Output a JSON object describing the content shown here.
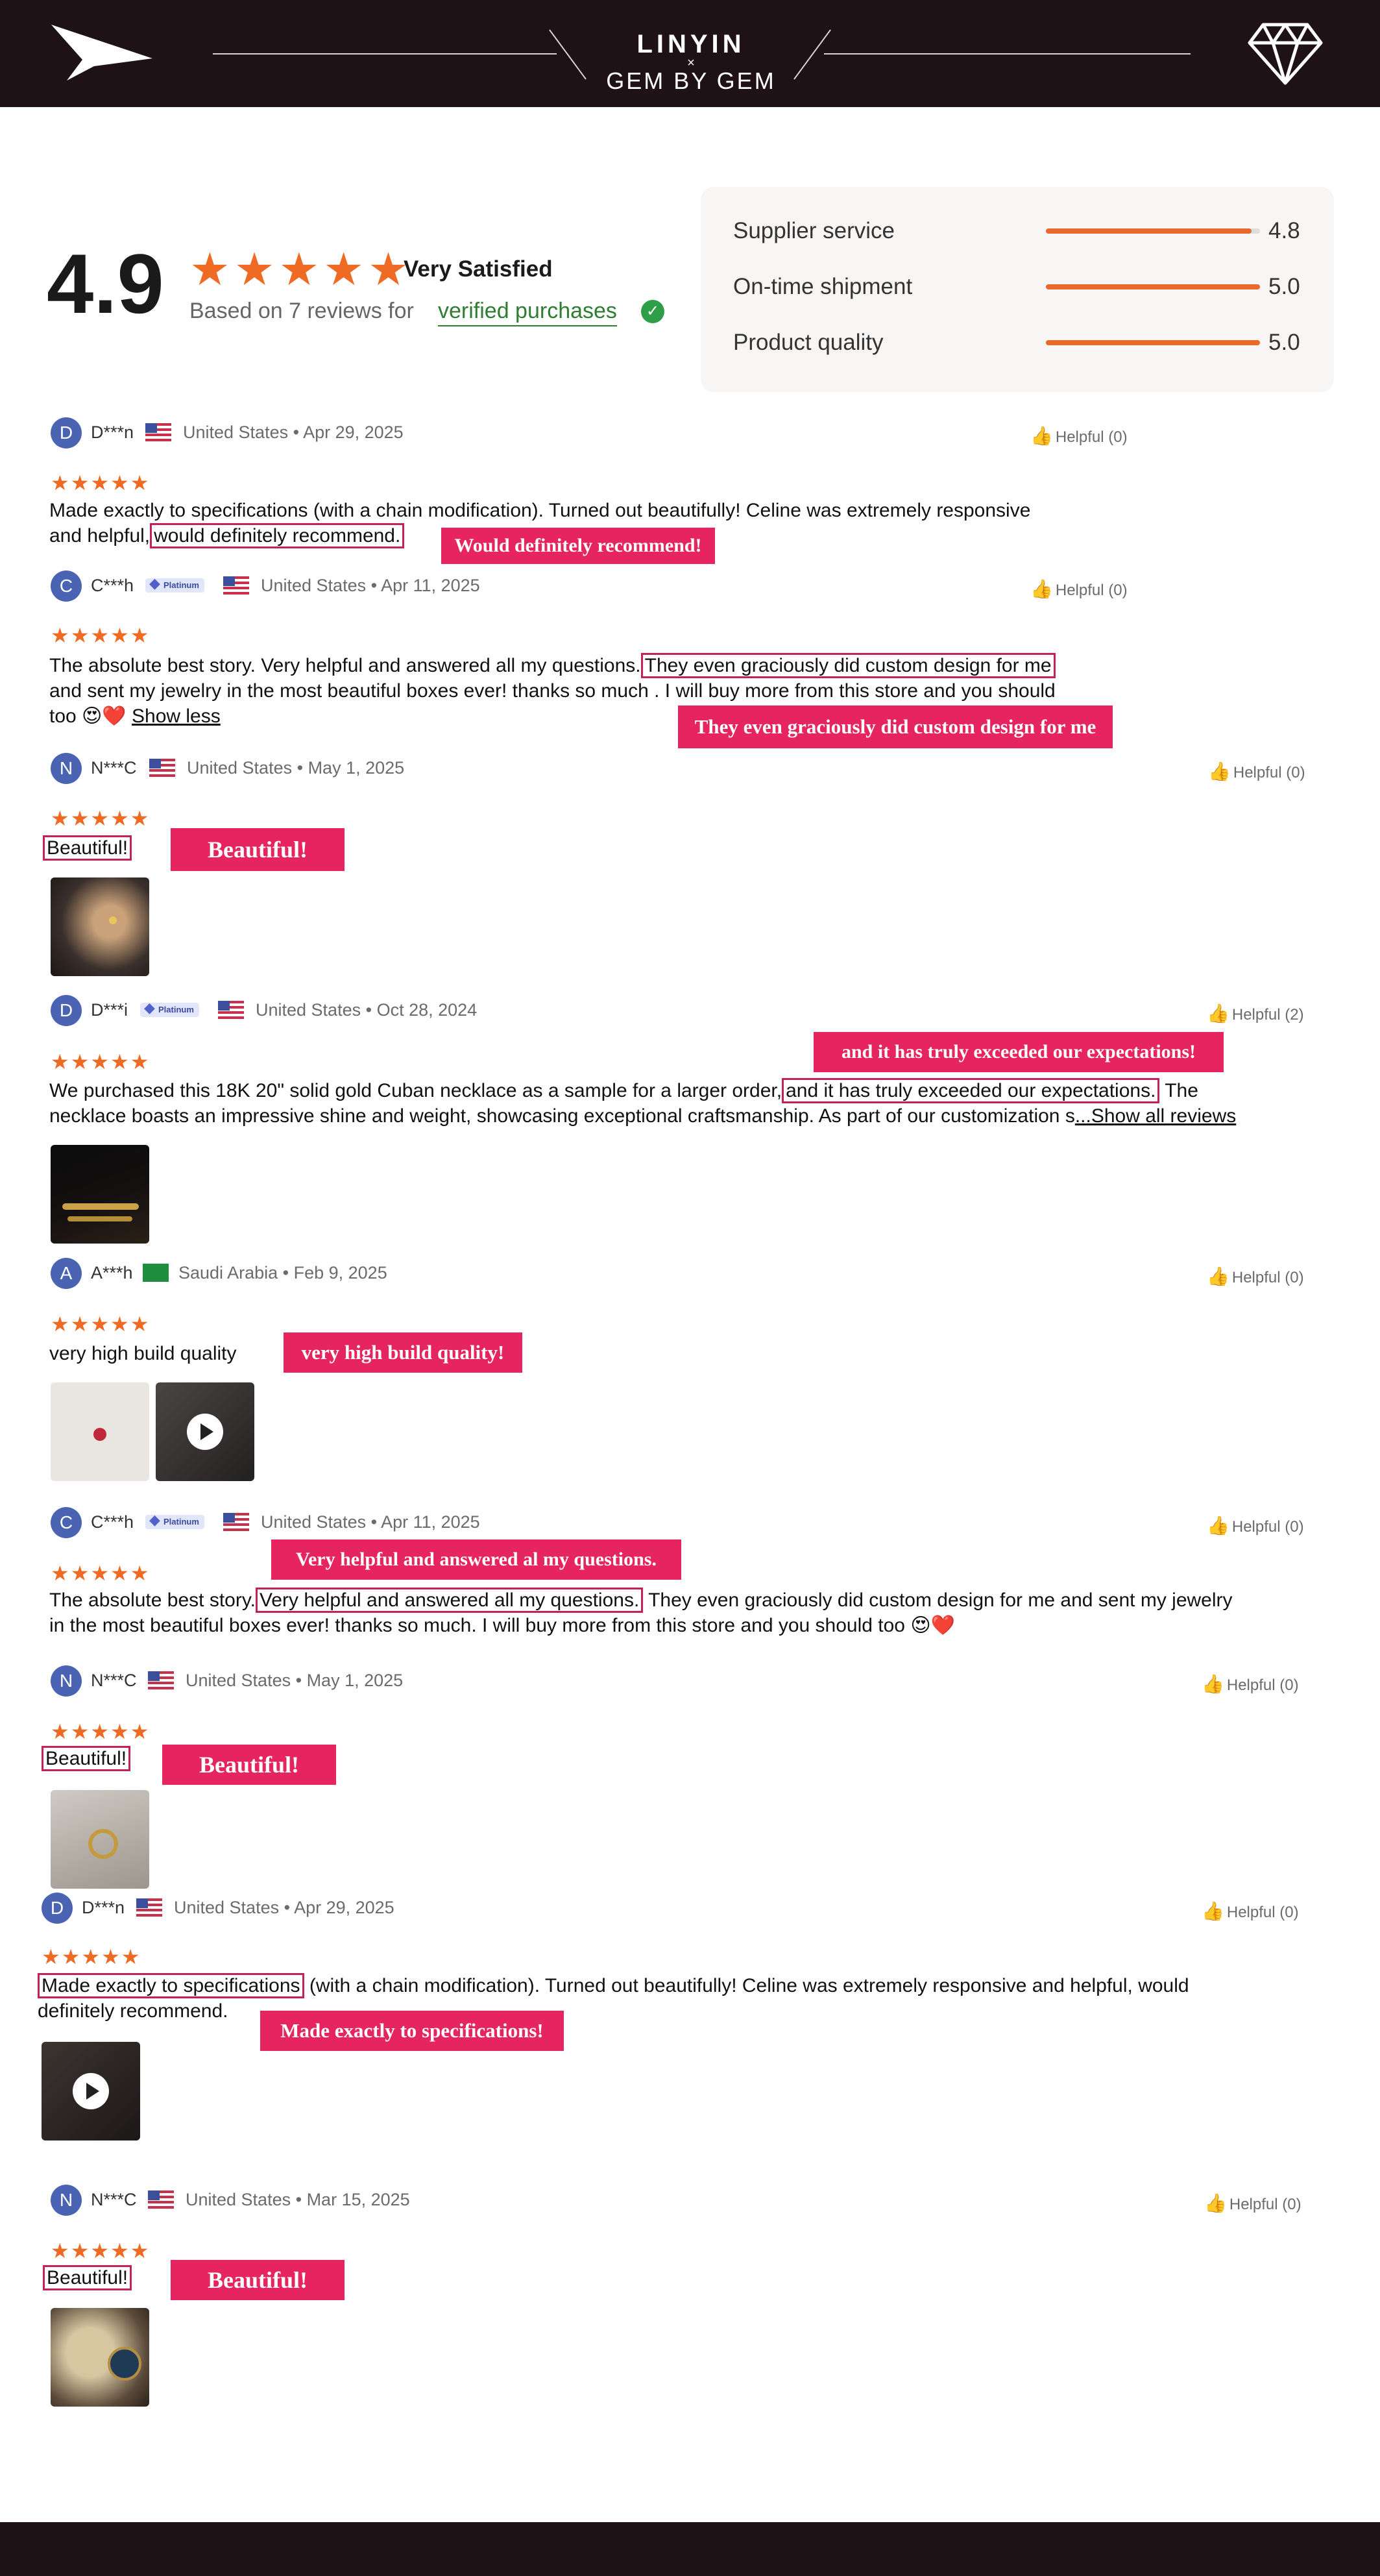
{
  "brand": {
    "primary": "LINYIN",
    "times": "×",
    "secondary": "GEM BY GEM",
    "logo_icon": "bird-wing-icon",
    "right_icon": "diamond-icon"
  },
  "colors": {
    "header_bg": "#1e1217",
    "accent_orange": "#ef6a23",
    "highlight": "#e6245f",
    "verified_green": "#2e7d32",
    "avatar_blue": "#4b63b3"
  },
  "summary": {
    "rating": "4.9",
    "stars": "★★★★★",
    "label": "Very Satisfied",
    "based_on": "Based on 7 reviews for",
    "verified_link": "verified purchases",
    "verified_icon": "verified-check-icon"
  },
  "scores": [
    {
      "label": "Supplier service",
      "value": "4.8",
      "fraction": 0.96
    },
    {
      "label": "On-time shipment",
      "value": "5.0",
      "fraction": 1.0
    },
    {
      "label": "Product quality",
      "value": "5.0",
      "fraction": 1.0
    }
  ],
  "reviews": [
    {
      "initial": "D",
      "name": "D***n",
      "country": "United States",
      "date": "Apr 29, 2025",
      "helpful": "Helpful (0)",
      "stars": "★★★★★",
      "text_a": "Made exactly to specifications (with a chain modification). Turned out beautifully! Celine was extremely responsive",
      "text_b": "and helpful,",
      "text_hl": "would definitely recommend.",
      "callout": "Would definitely recommend!"
    },
    {
      "initial": "C",
      "name": "C***h",
      "badge": "Platinum",
      "country": "United States",
      "date": "Apr 11, 2025",
      "helpful": "Helpful (0)",
      "stars": "★★★★★",
      "text_a": "The absolute best story. Very helpful and answered all my questions.",
      "text_hl": "They even graciously did custom design for me",
      "text_b": "and sent my jewelry in the most beautiful boxes ever! thanks so much . I will buy more from this store and you should",
      "text_c": "too 😍❤️",
      "show_less": "Show less",
      "callout": "They even graciously did custom design for me"
    },
    {
      "initial": "N",
      "name": "N***C",
      "country": "United States",
      "date": "May 1, 2025",
      "helpful": "Helpful (0)",
      "stars": "★★★★★",
      "text_hl": "Beautiful!",
      "callout": "Beautiful!"
    },
    {
      "initial": "D",
      "name": "D***i",
      "badge": "Platinum",
      "country": "United States",
      "date": "Oct 28, 2024",
      "helpful": "Helpful (2)",
      "stars": "★★★★★",
      "text_a": "We purchased this 18K 20\" solid gold Cuban necklace as a sample for a larger order,",
      "text_hl": "and it has truly exceeded our expectations.",
      "text_a2": "The",
      "text_b": "necklace boasts an impressive shine and weight, showcasing exceptional craftsmanship. As part of our customization s",
      "show_all": "...Show all reviews",
      "callout": "and it has truly exceeded our expectations!"
    },
    {
      "initial": "A",
      "name": "A***h",
      "country": "Saudi Arabia",
      "date": "Feb 9, 2025",
      "helpful": "Helpful (0)",
      "stars": "★★★★★",
      "text_a": "very high build quality",
      "callout": "very high build quality!"
    },
    {
      "initial": "C",
      "name": "C***h",
      "badge": "Platinum",
      "country": "United States",
      "date": "Apr 11, 2025",
      "helpful": "Helpful (0)",
      "stars": "★★★★★",
      "text_a": "The absolute best story.",
      "text_hl": "Very helpful and answered all my questions.",
      "text_a2": "They even graciously did custom design for me and sent my jewelry",
      "text_b": "in the most beautiful boxes ever! thanks so much. I will buy more from this store and you should too 😍❤️",
      "callout": "Very helpful and answered al my questions."
    },
    {
      "initial": "N",
      "name": "N***C",
      "country": "United States",
      "date": "May 1, 2025",
      "helpful": "Helpful (0)",
      "stars": "★★★★★",
      "text_hl": "Beautiful!",
      "callout": "Beautiful!"
    },
    {
      "initial": "D",
      "name": "D***n",
      "country": "United States",
      "date": "Apr 29, 2025",
      "helpful": "Helpful (0)",
      "stars": "★★★★★",
      "text_hl": "Made exactly to specifications",
      "text_a": "(with a chain modification). Turned out beautifully! Celine was extremely responsive and helpful, would",
      "text_b": "definitely recommend.",
      "callout": "Made exactly to specifications!"
    },
    {
      "initial": "N",
      "name": "N***C",
      "country": "United States",
      "date": "Mar 15, 2025",
      "helpful": "Helpful (0)",
      "stars": "★★★★★",
      "text_hl": "Beautiful!",
      "callout": "Beautiful!"
    }
  ],
  "icons": {
    "thumb_up": "thumbs-up-icon",
    "thumb_filled": "thumbs-up-filled-icon",
    "play": "play-icon"
  }
}
